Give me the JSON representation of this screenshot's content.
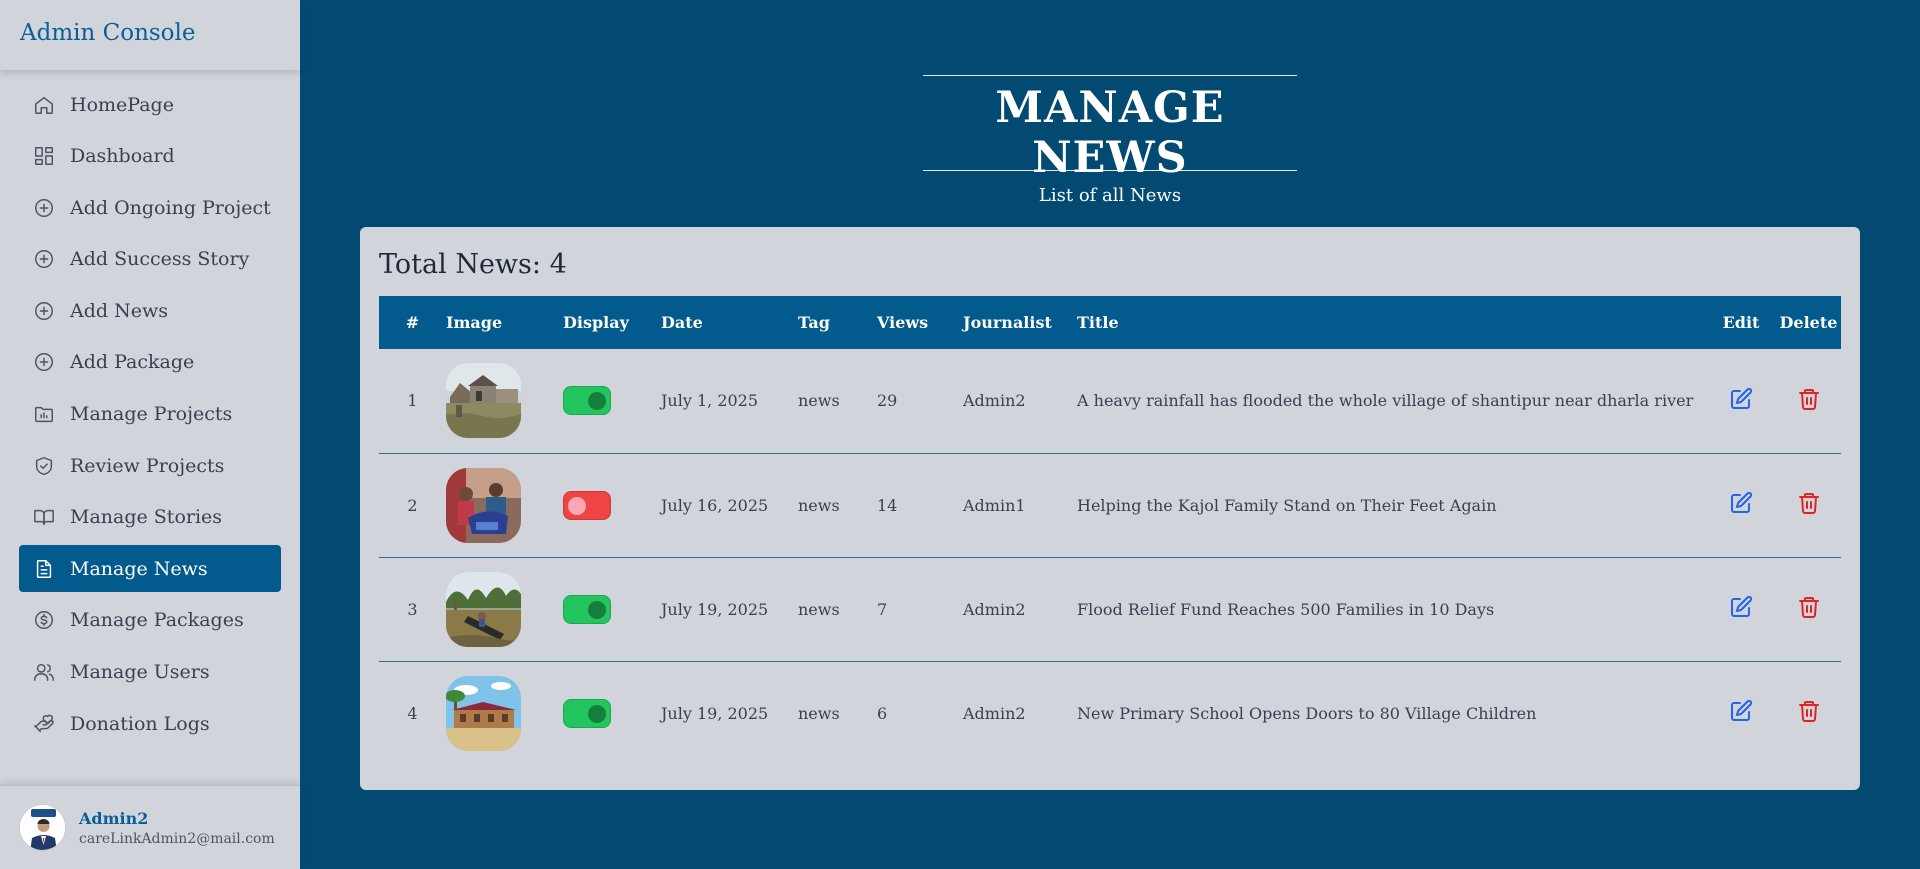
{
  "sidebar": {
    "brand": "Admin Console",
    "items": [
      {
        "label": "HomePage",
        "icon": "home-icon",
        "active": false
      },
      {
        "label": "Dashboard",
        "icon": "dashboard-icon",
        "active": false
      },
      {
        "label": "Add Ongoing Project",
        "icon": "plus-circle-icon",
        "active": false
      },
      {
        "label": "Add Success Story",
        "icon": "plus-circle-icon",
        "active": false
      },
      {
        "label": "Add News",
        "icon": "plus-circle-icon",
        "active": false
      },
      {
        "label": "Add Package",
        "icon": "plus-circle-icon",
        "active": false
      },
      {
        "label": "Manage Projects",
        "icon": "folder-chart-icon",
        "active": false
      },
      {
        "label": "Review Projects",
        "icon": "shield-check-icon",
        "active": false
      },
      {
        "label": "Manage Stories",
        "icon": "book-icon",
        "active": false
      },
      {
        "label": "Manage News",
        "icon": "document-icon",
        "active": true
      },
      {
        "label": "Manage Packages",
        "icon": "dollar-circle-icon",
        "active": false
      },
      {
        "label": "Manage Users",
        "icon": "users-icon",
        "active": false
      },
      {
        "label": "Donation Logs",
        "icon": "hand-heart-icon",
        "active": false
      }
    ],
    "user": {
      "name": "Admin2",
      "email": "careLinkAdmin2@mail.com"
    }
  },
  "header": {
    "title": "MANAGE NEWS",
    "subtitle": "List of all News"
  },
  "main": {
    "total_label": "Total News: 4",
    "table": {
      "columns": [
        "#",
        "Image",
        "Display",
        "Date",
        "Tag",
        "Views",
        "Journalist",
        "Title",
        "Edit",
        "Delete"
      ],
      "rows": [
        {
          "num": "1",
          "image": "flooded-village-thumbnail",
          "display": true,
          "date": "July 1, 2025",
          "tag": "news",
          "views": "29",
          "journalist": "Admin2",
          "title": "A heavy rainfall has flooded the whole village of shantipur near dharla river"
        },
        {
          "num": "2",
          "image": "family-relief-thumbnail",
          "display": false,
          "date": "July 16, 2025",
          "tag": "news",
          "views": "14",
          "journalist": "Admin1",
          "title": "Helping the Kajol Family Stand on Their Feet Again"
        },
        {
          "num": "3",
          "image": "flood-boat-thumbnail",
          "display": true,
          "date": "July 19, 2025",
          "tag": "news",
          "views": "7",
          "journalist": "Admin2",
          "title": "Flood Relief Fund Reaches 500 Families in 10 Days"
        },
        {
          "num": "4",
          "image": "primary-school-thumbnail",
          "display": true,
          "date": "July 19, 2025",
          "tag": "news",
          "views": "6",
          "journalist": "Admin2",
          "title": "New Primary School Opens Doors to 80 Village Children"
        }
      ]
    }
  },
  "colors": {
    "background": "#034a73",
    "accent": "#035a8c",
    "toggle_on": "#22c55e",
    "toggle_off": "#ef4444",
    "edit": "#2563eb",
    "delete": "#dc2626"
  }
}
